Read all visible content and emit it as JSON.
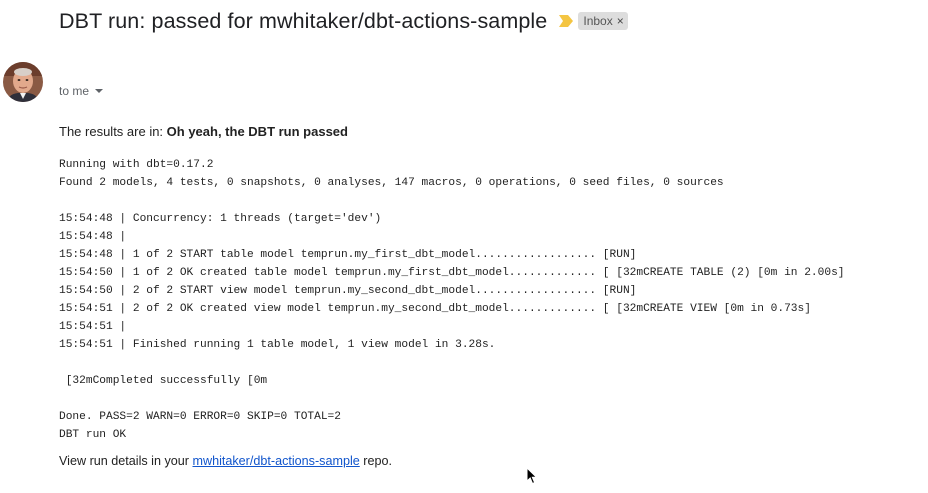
{
  "email": {
    "subject": "DBT run: passed for mwhitaker/dbt-actions-sample",
    "label": "Inbox",
    "label_remove": "×",
    "recipient": "to me",
    "intro_prefix": "The results are in: ",
    "intro_bold": "Oh yeah, the DBT run passed",
    "log_lines": [
      "Running with dbt=0.17.2",
      "Found 2 models, 4 tests, 0 snapshots, 0 analyses, 147 macros, 0 operations, 0 seed files, 0 sources",
      "",
      "15:54:48 | Concurrency: 1 threads (target='dev')",
      "15:54:48 | ",
      "15:54:48 | 1 of 2 START table model temprun.my_first_dbt_model.................. [RUN]",
      "15:54:50 | 1 of 2 OK created table model temprun.my_first_dbt_model............. [ [32mCREATE TABLE (2) [0m in 2.00s]",
      "15:54:50 | 2 of 2 START view model temprun.my_second_dbt_model.................. [RUN]",
      "15:54:51 | 2 of 2 OK created view model temprun.my_second_dbt_model............. [ [32mCREATE VIEW [0m in 0.73s]",
      "15:54:51 | ",
      "15:54:51 | Finished running 1 table model, 1 view model in 3.28s.",
      "",
      " [32mCompleted successfully [0m",
      "",
      "Done. PASS=2 WARN=0 ERROR=0 SKIP=0 TOTAL=2",
      "DBT run OK"
    ],
    "footer_prefix": "View run details in your ",
    "footer_link": "mwhitaker/dbt-actions-sample",
    "footer_suffix": " repo."
  },
  "icons": {
    "importance": "importance-marker-icon",
    "avatar": "sender-avatar",
    "recipient_caret": "chevron-down-icon",
    "cursor": "mouse-pointer-icon"
  },
  "colors": {
    "importance_marker": "#f4c542",
    "link": "#1155cc",
    "label_chip_bg": "#dddddd"
  }
}
